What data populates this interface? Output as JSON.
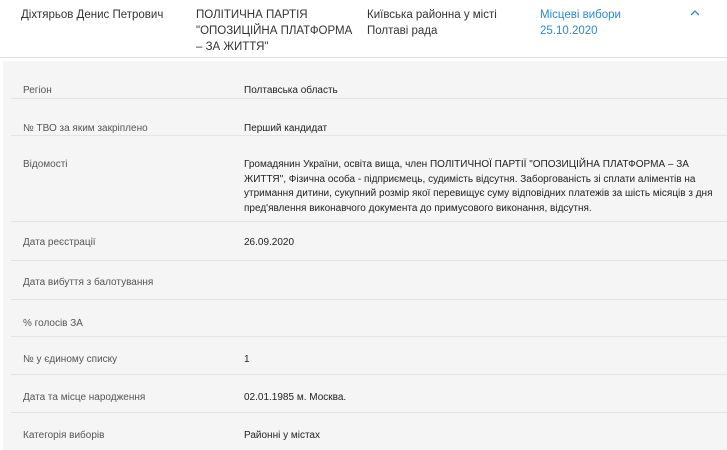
{
  "header": {
    "candidate_name": "Діхтярьов Денис Петрович",
    "party": "ПОЛІТИЧНА ПАРТІЯ \"ОПОЗИЦІЙНА ПЛАТФОРМА – ЗА ЖИТТЯ\"",
    "council": "Київська районна у місті Полтаві рада",
    "election": "Місцеві вибори 25.10.2020",
    "chevron_icon": "chevron-up-icon",
    "accent_color": "#2b8ad8"
  },
  "details": {
    "rows": [
      {
        "label": "Регіон",
        "value": "Полтавська область"
      },
      {
        "label": "№ ТВО за яким закріплено",
        "value": "Перший кандидат"
      },
      {
        "label": "Відомості",
        "value": "Громадянин України, освіта вища, член ПОЛІТИЧНОЇ ПАРТІЇ \"ОПОЗИЦІЙНА ПЛАТФОРМА – ЗА ЖИТТЯ\", Фізична особа - підприємець, судимість відсутня. Заборгованість зі сплати аліментів на утримання дитини, сукупний розмір якої перевищує суму відповідних платежів за шість місяців з дня пред'явлення виконавчого документа до примусового виконання, відсутня."
      },
      {
        "label": "Дата реєстрації",
        "value": "26.09.2020"
      },
      {
        "label": "Дата вибуття з балотування",
        "value": ""
      },
      {
        "label": "% голосів ЗА",
        "value": ""
      },
      {
        "label": "№ у єдиному списку",
        "value": "1"
      },
      {
        "label": "Дата та місце народження",
        "value": "02.01.1985 м. Москва."
      },
      {
        "label": "Категорія виборів",
        "value": "Районні у містах"
      }
    ]
  }
}
